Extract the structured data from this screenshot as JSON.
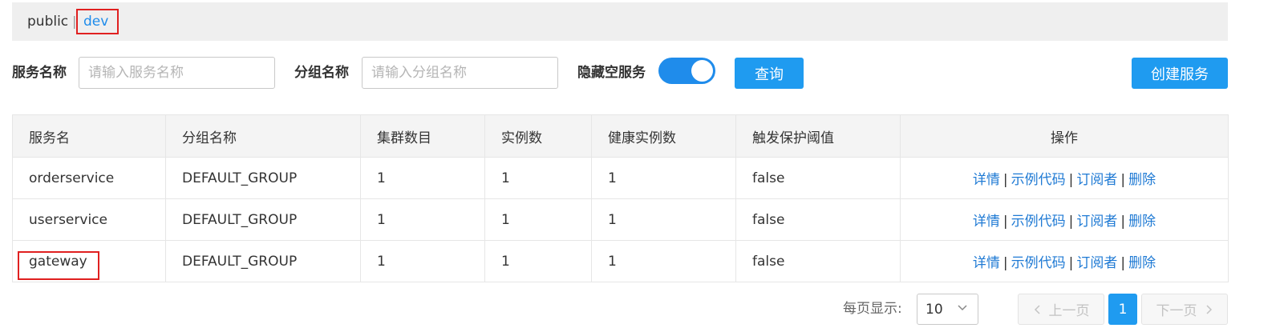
{
  "namespaces": {
    "public": "public",
    "separator": "|",
    "dev": "dev"
  },
  "filters": {
    "service_label": "服务名称",
    "service_placeholder": "请输入服务名称",
    "group_label": "分组名称",
    "group_placeholder": "请输入分组名称",
    "hide_empty_label": "隐藏空服务",
    "hide_empty_on": true,
    "query_button": "查询",
    "create_button": "创建服务"
  },
  "table": {
    "headers": [
      "服务名",
      "分组名称",
      "集群数目",
      "实例数",
      "健康实例数",
      "触发保护阈值",
      "操作"
    ],
    "rows": [
      {
        "name": "orderservice",
        "group": "DEFAULT_GROUP",
        "clusters": "1",
        "instances": "1",
        "healthy": "1",
        "threshold": "false"
      },
      {
        "name": "userservice",
        "group": "DEFAULT_GROUP",
        "clusters": "1",
        "instances": "1",
        "healthy": "1",
        "threshold": "false"
      },
      {
        "name": "gateway",
        "group": "DEFAULT_GROUP",
        "clusters": "1",
        "instances": "1",
        "healthy": "1",
        "threshold": "false"
      }
    ],
    "actions": {
      "detail": "详情",
      "sample": "示例代码",
      "subscribers": "订阅者",
      "delete": "删除",
      "separator": "|"
    }
  },
  "pagination": {
    "page_size_label": "每页显示:",
    "page_size": "10",
    "prev": "上一页",
    "current": "1",
    "next": "下一页"
  },
  "colors": {
    "accent": "#1f9bf0",
    "link": "#1f7ad4",
    "highlight_box": "#e02020"
  }
}
